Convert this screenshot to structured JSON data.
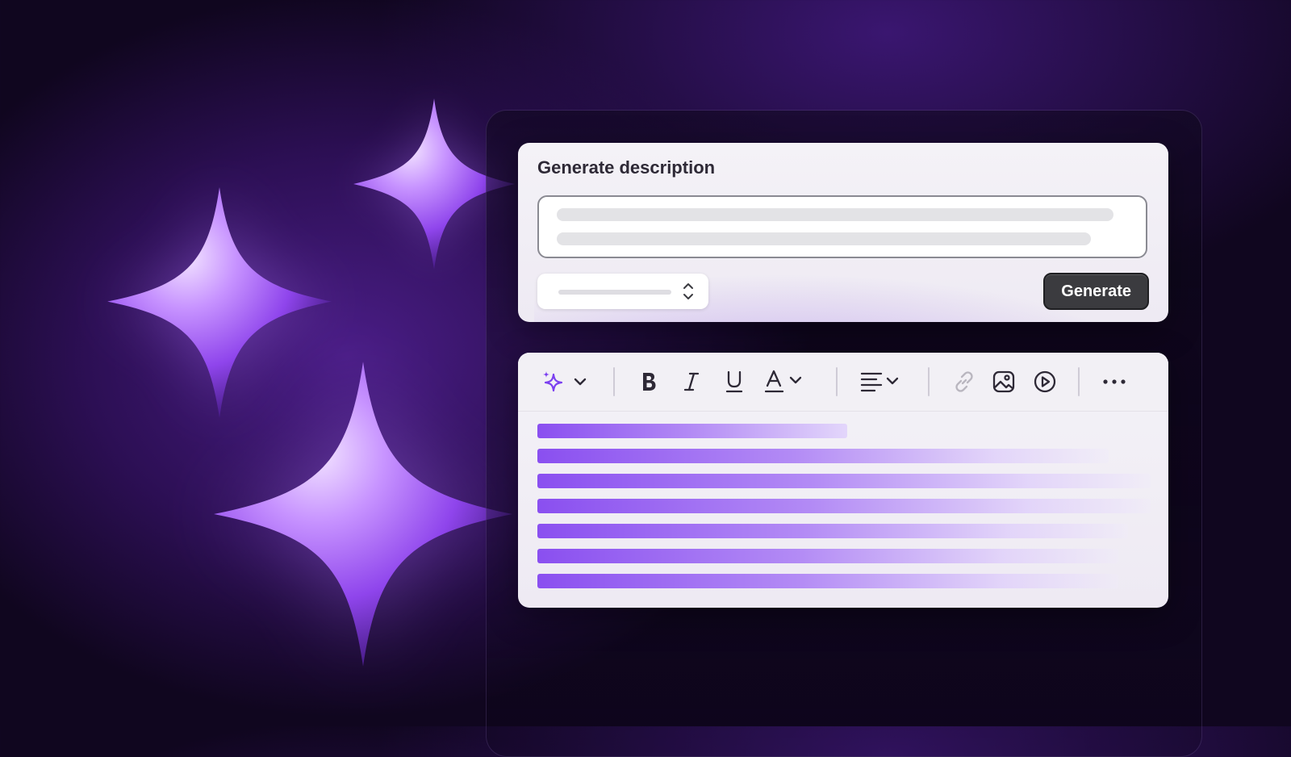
{
  "generator": {
    "title": "Generate description",
    "button_label": "Generate",
    "prompt_icon": "text-placeholder",
    "select_icon": "chevron-up-down-icon"
  },
  "editor": {
    "toolbar": [
      {
        "name": "ai-sparkle-icon"
      },
      {
        "name": "chevron-down-icon"
      },
      {
        "name": "bold-icon"
      },
      {
        "name": "italic-icon"
      },
      {
        "name": "underline-icon"
      },
      {
        "name": "text-color-icon"
      },
      {
        "name": "align-icon"
      },
      {
        "name": "link-icon"
      },
      {
        "name": "image-icon"
      },
      {
        "name": "video-icon"
      },
      {
        "name": "more-icon"
      }
    ]
  },
  "colors": {
    "accent": "#8a4ff0",
    "button": "#3b3b3f",
    "background": "#10061f",
    "sparkle": "#9b5cf0"
  }
}
